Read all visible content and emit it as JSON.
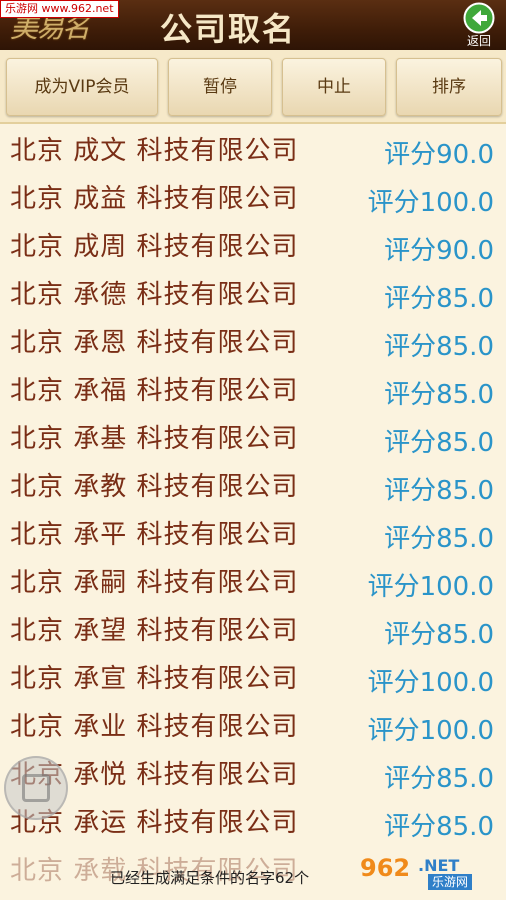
{
  "header": {
    "watermark": "乐游网 www.962.net",
    "logo_text": "美易名",
    "title": "公司取名",
    "back_label": "返回"
  },
  "toolbar": {
    "vip_label": "成为VIP会员",
    "pause_label": "暂停",
    "stop_label": "中止",
    "sort_label": "排序"
  },
  "names": [
    {
      "name": "北京 成文 科技有限公司",
      "score": "评分90.0"
    },
    {
      "name": "北京 成益 科技有限公司",
      "score": "评分100.0"
    },
    {
      "name": "北京 成周 科技有限公司",
      "score": "评分90.0"
    },
    {
      "name": "北京 承德 科技有限公司",
      "score": "评分85.0"
    },
    {
      "name": "北京 承恩 科技有限公司",
      "score": "评分85.0"
    },
    {
      "name": "北京 承福 科技有限公司",
      "score": "评分85.0"
    },
    {
      "name": "北京 承基 科技有限公司",
      "score": "评分85.0"
    },
    {
      "name": "北京 承教 科技有限公司",
      "score": "评分85.0"
    },
    {
      "name": "北京 承平 科技有限公司",
      "score": "评分85.0"
    },
    {
      "name": "北京 承嗣 科技有限公司",
      "score": "评分100.0"
    },
    {
      "name": "北京 承望 科技有限公司",
      "score": "评分85.0"
    },
    {
      "name": "北京 承宣 科技有限公司",
      "score": "评分100.0"
    },
    {
      "name": "北京 承业 科技有限公司",
      "score": "评分100.0"
    },
    {
      "name": "北京 承悦 科技有限公司",
      "score": "评分85.0"
    },
    {
      "name": "北京 承运 科技有限公司",
      "score": "评分85.0"
    },
    {
      "name": "北京 承载 科技有限公司",
      "score": ""
    }
  ],
  "status": {
    "text": "已经生成满足条件的名字62个"
  },
  "site_badge": {
    "number": "962",
    "net": ".NET",
    "cn": "乐游网"
  }
}
